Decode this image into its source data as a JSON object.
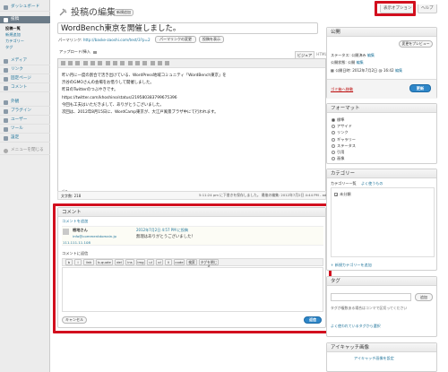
{
  "sidebar": {
    "dashboard": "ダッシュボード",
    "posts": "投稿",
    "posts_sub": [
      "投稿一覧",
      "新規追加",
      "カテゴリー",
      "タグ"
    ],
    "items": [
      "メディア",
      "リンク",
      "固定ページ",
      "コメント",
      "外観",
      "プラグイン",
      "ユーザー",
      "ツール",
      "設定"
    ],
    "collapse": "メニューを閉じる"
  },
  "top": {
    "screen_options": "表示オプション",
    "help": "ヘルプ"
  },
  "header": {
    "title": "投稿の編集",
    "add_new": "新規追加"
  },
  "post": {
    "title": "WordBench東京を開催しました。",
    "permalink_label": "パーマリンク:",
    "permalink_url": "http://baske-zaoshi.com/test/3?p=2",
    "change_permalink": "パーマリンクの変更",
    "view_post": "投稿を表示",
    "upload_insert": "アップロード/挿入",
    "tab_visual": "ビジュアル",
    "tab_html": "HTML",
    "content_lines": [
      "昨い月に一度の割合で活き出けている、WordPress地域コミュニティ「WordBench東京」を",
      "渋谷のGMOさんの会場をお借りして開催しました。",
      "昨日のTwitterのつぶやきです。",
      "https://twitter.com/khoshino/status/219580383799675396",
      "今回も工夫はいただきまして、ありがとうございました。",
      "次回は、2012年8月15日に、WordCamp東京が、大江戸風景ブラザ中にて行われます。"
    ],
    "path": "パス: p",
    "word_count": "文字数: 218",
    "last_edited": "5:11:24 pm に下書きを保存しました。 最後の編集: 2012年7月2日 4:44 PM - admin"
  },
  "comments": {
    "heading": "コメント",
    "add_comment": "コメントを追加",
    "author_name": "根地さん",
    "author_email": "info@commentdomain.jp",
    "author_ip": "111.111.11.108",
    "comment_date": "2012年7月2日 4:57 PM に投稿",
    "comment_text": "無理はありがとうございました！",
    "reply_label": "コメントに返信",
    "toolbar": [
      "b",
      "i",
      "link",
      "b-quote",
      "del",
      "ins",
      "img",
      "ul",
      "ol",
      "li",
      "code",
      "検索",
      "タグを閉じる"
    ],
    "cancel": "キャンセル",
    "submit": "返信"
  },
  "publish": {
    "heading": "公開",
    "preview": "変更をプレビュー",
    "status": "ステータス: 公開済み",
    "status_edit": "編集",
    "visibility": "公開状態: 公開",
    "visibility_edit": "編集",
    "date": "公開日時: 2012年7月2日 @ 16:42",
    "date_edit": "編集",
    "trash": "ゴミ箱へ移動",
    "update": "更新"
  },
  "format": {
    "heading": "フォーマット",
    "options": [
      "標準",
      "アサイド",
      "リンク",
      "ギャラリー",
      "ステータス",
      "引用",
      "画像"
    ],
    "selected": 0
  },
  "category": {
    "heading": "カテゴリー",
    "tab_all": "カテゴリー一覧",
    "tab_popular": "よく使うもの",
    "items": [
      "未分類"
    ],
    "add_new": "+ 新規カテゴリーを追加"
  },
  "tags": {
    "heading": "タグ",
    "add": "追加",
    "help": "タグが複数ある場合はコンマで区切ってください",
    "choose": "よく使われているタグから選択"
  },
  "thumbnail": {
    "heading": "アイキャッチ画像",
    "set": "アイキャッチ画像を設定"
  },
  "colors": {
    "accent": "#d20f1e",
    "link": "#21759b",
    "primary": "#2e86c8",
    "trash": "#bc0b0b"
  }
}
